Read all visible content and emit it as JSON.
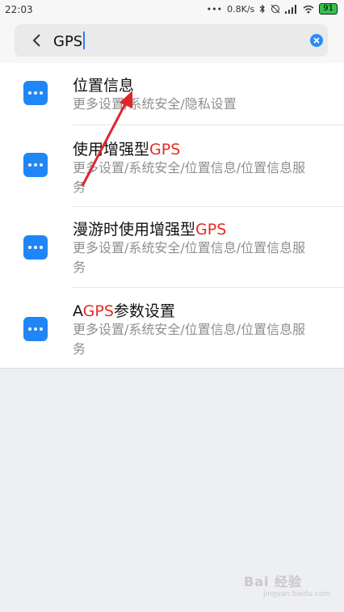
{
  "status_bar": {
    "time": "22:03",
    "dots": "•••",
    "speed": "0.8K/s",
    "battery": "91",
    "icons": [
      "bluetooth-icon",
      "alarm-off-icon",
      "signal-icon",
      "wifi-icon",
      "battery-icon"
    ]
  },
  "search": {
    "query": "GPS",
    "back_icon": "chevron-left-icon",
    "clear_icon": "clear-icon"
  },
  "results": [
    {
      "title_pre": "位置信息",
      "title_hl": "",
      "path": "更多设置/系统安全/隐私设置"
    },
    {
      "title_pre": "使用增强型",
      "title_hl": "GPS",
      "path": "更多设置/系统安全/位置信息/位置信息服务"
    },
    {
      "title_pre": "漫游时使用增强型",
      "title_hl": "GPS",
      "path": "更多设置/系统安全/位置信息/位置信息服务"
    },
    {
      "title_pre": "A",
      "title_hl": "GPS",
      "title_post": "参数设置",
      "path": "更多设置/系统安全/位置信息/位置信息服务"
    }
  ],
  "annotation": {
    "type": "red-arrow",
    "color": "#e0242c"
  },
  "watermark": {
    "text": "Bai 经验",
    "sub": "jingyan.baidu.com"
  },
  "colors": {
    "accent": "#1f86f5",
    "highlight": "#e42b22"
  }
}
